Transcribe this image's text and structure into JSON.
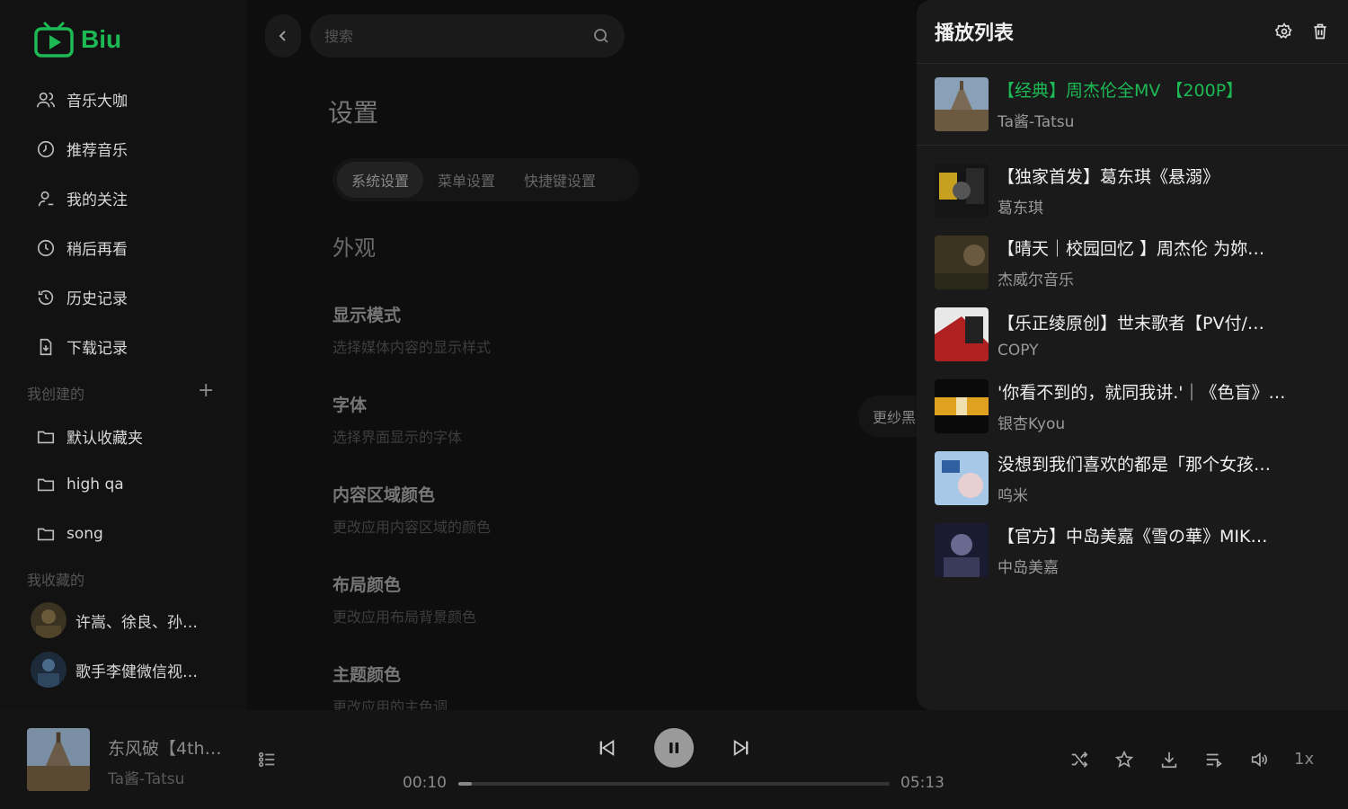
{
  "app": {
    "name": "Biu",
    "accent": "#1db954"
  },
  "sidebar": {
    "nav": [
      {
        "label": "音乐大咖",
        "icon": "users-icon"
      },
      {
        "label": "推荐音乐",
        "icon": "compass-icon"
      },
      {
        "label": "我的关注",
        "icon": "user-icon"
      },
      {
        "label": "稍后再看",
        "icon": "clock-icon"
      },
      {
        "label": "历史记录",
        "icon": "history-icon"
      },
      {
        "label": "下载记录",
        "icon": "download-file-icon"
      }
    ],
    "created_label": "我创建的",
    "created": [
      {
        "label": "默认收藏夹"
      },
      {
        "label": "high qa"
      },
      {
        "label": "song"
      }
    ],
    "collected_label": "我收藏的",
    "collected": [
      {
        "label": "许嵩、徐良、孙…"
      },
      {
        "label": "歌手李健微信视…"
      }
    ]
  },
  "main": {
    "search_placeholder": "搜索",
    "title": "设置",
    "tabs": [
      {
        "label": "系统设置",
        "active": true
      },
      {
        "label": "菜单设置",
        "active": false
      },
      {
        "label": "快捷键设置",
        "active": false
      }
    ],
    "section": "外观",
    "settings": [
      {
        "title": "显示模式",
        "desc": "选择媒体内容的显示样式"
      },
      {
        "title": "字体",
        "desc": "选择界面显示的字体"
      },
      {
        "title": "内容区域颜色",
        "desc": "更改应用内容区域的颜色"
      },
      {
        "title": "布局颜色",
        "desc": "更改应用布局背景颜色"
      },
      {
        "title": "主题颜色",
        "desc": "更改应用的主色调"
      }
    ],
    "font_value": "更纱黑"
  },
  "playlist": {
    "title": "播放列表",
    "current": {
      "title": "【经典】周杰伦全MV 【200P】",
      "artist": "Ta酱-Tatsu"
    },
    "items": [
      {
        "title": "【独家首发】葛东琪《悬溺》",
        "artist": "葛东琪"
      },
      {
        "title": "【晴天｜校园回忆 】周杰伦 为妳…",
        "artist": "杰威尔音乐"
      },
      {
        "title": "【乐正绫原创】世末歌者【PV付/…",
        "artist": "COPY"
      },
      {
        "title": "'你看不到的，就同我讲.'｜《色盲》…",
        "artist": "银杏Kyou"
      },
      {
        "title": "没想到我们喜欢的都是「那个女孩…",
        "artist": "呜米"
      },
      {
        "title": "【官方】中岛美嘉《雪の華》MIK…",
        "artist": "中岛美嘉"
      }
    ]
  },
  "player": {
    "title": "东风破【4th…",
    "artist": "Ta酱-Tatsu",
    "current_time": "00:10",
    "total_time": "05:13",
    "progress": 0.032,
    "rate": "1x"
  }
}
